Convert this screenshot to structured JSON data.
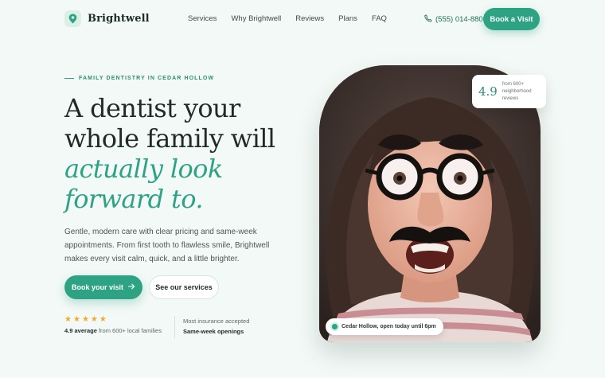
{
  "brand": {
    "name": "Brightwell",
    "icon": "tooth-pin-icon",
    "accent": "#2ea384"
  },
  "nav": {
    "items": [
      {
        "label": "Services"
      },
      {
        "label": "Why Brightwell"
      },
      {
        "label": "Reviews"
      },
      {
        "label": "Plans"
      },
      {
        "label": "FAQ"
      }
    ],
    "phone": "(555) 014-8800",
    "phone_icon": "phone-icon",
    "cta": "Book a Visit"
  },
  "hero": {
    "eyebrow": "FAMILY DENTISTRY IN CEDAR HOLLOW",
    "headline_line1": "A dentist your",
    "headline_line2": "whole family will",
    "headline_accent1": "actually look",
    "headline_accent2": "forward to.",
    "lede": "Gentle, modern care with clear pricing and same-week appointments. From first tooth to flawless smile, Brightwell makes every visit calm, quick, and a little brighter.",
    "primary_cta": "Book your visit",
    "primary_cta_icon": "arrow-right-icon",
    "secondary_cta": "See our services",
    "stars": 5,
    "rating_bold": "4.9 average",
    "rating_rest": " from 600+ local families",
    "insurance_line": "Most insurance accepted",
    "openings_line": "Same-week openings"
  },
  "photo": {
    "rating_value": "4.9",
    "rating_note": "from 600+ neighborhood reviews",
    "location": "Cedar Hollow, open today until 6pm"
  }
}
